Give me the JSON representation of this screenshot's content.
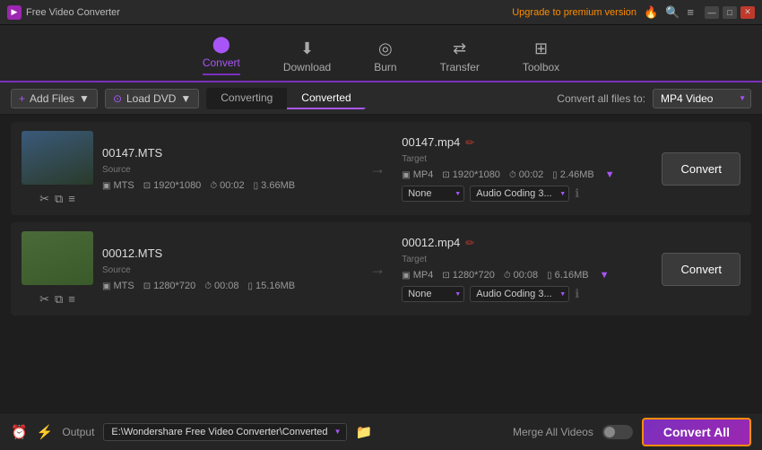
{
  "titlebar": {
    "logo_text": "Free Video Converter",
    "upgrade_text": "Upgrade to premium version",
    "win_minimize": "—",
    "win_maximize": "□",
    "win_close": "✕"
  },
  "navbar": {
    "items": [
      {
        "id": "convert",
        "label": "Convert",
        "icon": "▶",
        "active": true
      },
      {
        "id": "download",
        "label": "Download",
        "icon": "⬇"
      },
      {
        "id": "burn",
        "label": "Burn",
        "icon": "⬤"
      },
      {
        "id": "transfer",
        "label": "Transfer",
        "icon": "⇄"
      },
      {
        "id": "toolbox",
        "label": "Toolbox",
        "icon": "⊞"
      }
    ]
  },
  "toolbar": {
    "add_files": "Add Files",
    "load_dvd": "Load DVD",
    "tab_converting": "Converting",
    "tab_converted": "Converted",
    "convert_all_files_label": "Convert all files to:",
    "format_value": "MP4 Video"
  },
  "files": [
    {
      "id": "file1",
      "source_name": "00147.MTS",
      "target_name": "00147.mp4",
      "source": {
        "format": "MTS",
        "resolution": "1920*1080",
        "duration": "00:02",
        "size": "3.66MB"
      },
      "target": {
        "format": "MP4",
        "resolution": "1920*1080",
        "duration": "00:02",
        "size": "2.46MB"
      },
      "subtitle": "None",
      "audio": "Audio Coding 3...",
      "convert_btn": "Convert"
    },
    {
      "id": "file2",
      "source_name": "00012.MTS",
      "target_name": "00012.mp4",
      "source": {
        "format": "MTS",
        "resolution": "1280*720",
        "duration": "00:08",
        "size": "15.16MB"
      },
      "target": {
        "format": "MP4",
        "resolution": "1280*720",
        "duration": "00:08",
        "size": "6.16MB"
      },
      "subtitle": "None",
      "audio": "Audio Coding 3...",
      "convert_btn": "Convert"
    }
  ],
  "bottombar": {
    "output_label": "Output",
    "output_path": "E:\\Wondershare Free Video Converter\\Converted",
    "merge_label": "Merge All Videos",
    "convert_all_btn": "Convert All"
  }
}
